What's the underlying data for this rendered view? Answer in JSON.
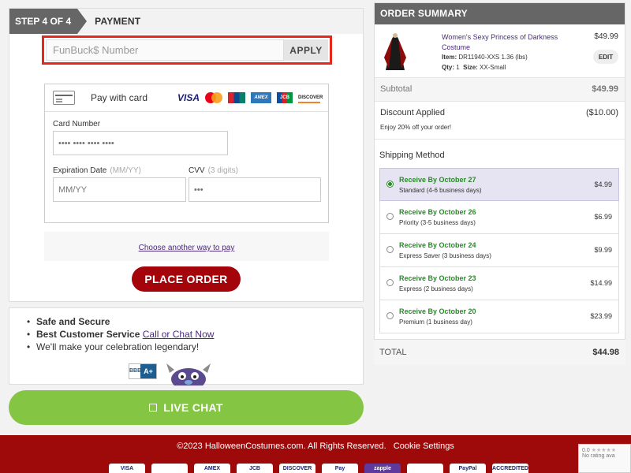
{
  "checkout": {
    "step_label": "STEP 4 OF 4",
    "step_title": "PAYMENT",
    "funbucks": {
      "placeholder": "FunBuck$ Number",
      "apply_label": "APPLY"
    },
    "card": {
      "header_label": "Pay with card",
      "logos": [
        "VISA",
        "mastercard",
        "UnionPay",
        "AMEX",
        "JCB",
        "DISCOVER"
      ],
      "card_number_label": "Card Number",
      "card_number_placeholder": "•••• •••• •••• ••••",
      "expiration_label": "Expiration Date",
      "expiration_hint": "(MM/YY)",
      "expiration_placeholder": "MM/YY",
      "cvv_label": "CVV",
      "cvv_hint": "(3 digits)",
      "cvv_placeholder": "•••"
    },
    "other_pay_label": "Choose another way to pay",
    "place_order_label": "PLACE ORDER"
  },
  "info": {
    "safe": "Safe and Secure",
    "service_prefix": "Best Customer Service",
    "service_link": "Call or Chat Now",
    "tagline": "We'll make your celebration legendary!",
    "bbb_rating": "A+"
  },
  "live_chat_label": "LIVE CHAT",
  "summary": {
    "header": "ORDER SUMMARY",
    "item": {
      "name": "Women's Sexy Princess of Darkness Costume",
      "item_label": "Item:",
      "item_value": "DR11940-XXS 1.36 (lbs)",
      "qty_label": "Qty:",
      "qty_value": "1",
      "size_label": "Size:",
      "size_value": "XX-Small",
      "price": "$49.99",
      "edit_label": "EDIT"
    },
    "subtotal_label": "Subtotal",
    "subtotal_value": "$49.99",
    "discount_label": "Discount Applied",
    "discount_value": "($10.00)",
    "discount_note": "Enjoy 20% off your order!",
    "shipping_title": "Shipping Method",
    "shipping_options": [
      {
        "date": "Receive By October 27",
        "desc": "Standard (4-6 business days)",
        "price": "$4.99",
        "selected": true
      },
      {
        "date": "Receive By October 26",
        "desc": "Priority (3-5 business days)",
        "price": "$6.99",
        "selected": false
      },
      {
        "date": "Receive By October 24",
        "desc": "Express Saver (3 business days)",
        "price": "$9.99",
        "selected": false
      },
      {
        "date": "Receive By October 23",
        "desc": "Express (2 business days)",
        "price": "$14.99",
        "selected": false
      },
      {
        "date": "Receive By October 20",
        "desc": "Premium (1 business day)",
        "price": "$23.99",
        "selected": false
      }
    ],
    "total_label": "TOTAL",
    "total_value": "$44.98"
  },
  "footer": {
    "copyright": "©2023 HalloweenCostumes.com. All Rights Reserved.",
    "cookie_label": "Cookie Settings",
    "payment_badges": [
      "VISA",
      "",
      "AMEX",
      "JCB",
      "DISCOVER",
      "Pay",
      "zapple",
      "",
      "PayPal",
      "ACCREDITED"
    ]
  },
  "recaptcha": {
    "score": "0.0",
    "stars": "★★★★★",
    "label": "No rating ava"
  },
  "colors": {
    "brand_red": "#9e0a0a",
    "place_order": "#a3050a",
    "chat_green": "#84c544",
    "ship_green": "#2a8a2a",
    "link_purple": "#4a2a7a",
    "highlight_red": "#e8271c"
  }
}
